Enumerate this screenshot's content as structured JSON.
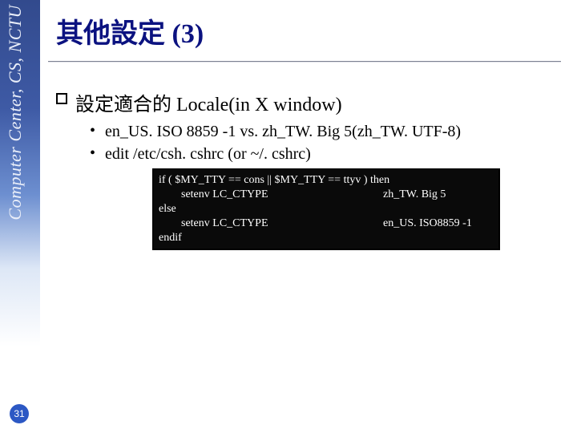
{
  "sidebar": {
    "text": "Computer Center, CS, NCTU"
  },
  "title": {
    "zh": "其他設定 ",
    "paren_open": "(",
    "num": "3",
    "paren_close": ")"
  },
  "body": {
    "lvl1": {
      "zh": "設定適合的 ",
      "latin": "Locale(in X window)"
    },
    "lvl2a": "en_US. ISO 8859 -1 vs. zh_TW. Big 5(zh_TW. UTF-8)",
    "lvl2b": "edit /etc/csh. cshrc (or ~/. cshrc)"
  },
  "code": {
    "l1": "if ( $MY_TTY == cons || $MY_TTY == ttyv ) then",
    "l2a": "        setenv LC_CTYPE",
    "l2b": "zh_TW. Big 5",
    "l3": "else",
    "l4a": "        setenv LC_CTYPE",
    "l4b": "en_US. ISO8859 -1",
    "l5": "endif"
  },
  "page": {
    "num": "31"
  }
}
